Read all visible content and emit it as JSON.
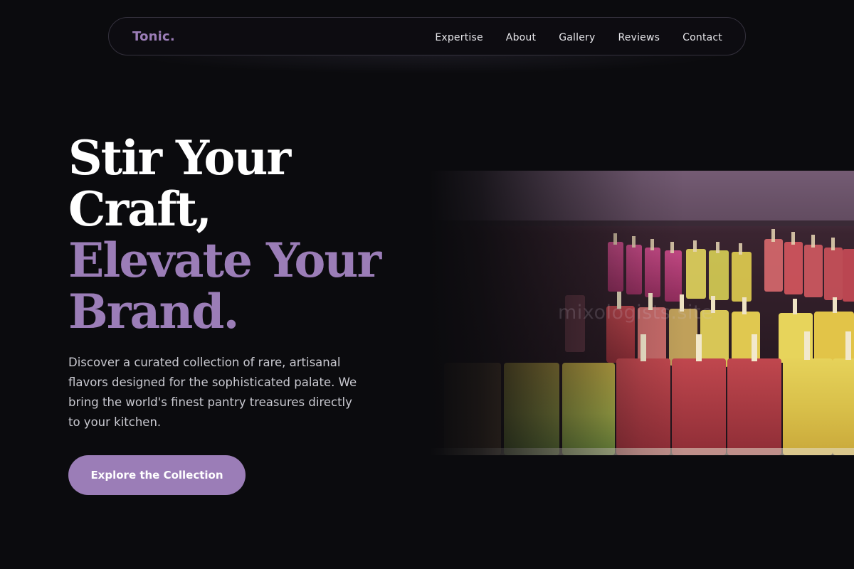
{
  "nav": {
    "brand": "Tonic.",
    "links": [
      "Expertise",
      "About",
      "Gallery",
      "Reviews",
      "Contact"
    ]
  },
  "hero": {
    "headline": [
      "Stir Your",
      "Craft,",
      "Elevate Your",
      "Brand."
    ],
    "description": "Discover a curated collection of rare, artisanal flavors designed for the sophisticated palate. We bring the world's finest pantry treasures directly to your kitchen.",
    "cta_label": "Explore the Collection",
    "image_watermark": "mixologists.site"
  },
  "colors": {
    "background": "#0b0b0e",
    "accent": "#9b7db7",
    "text": "#ffffff",
    "body_text": "#c9c9d0",
    "nav_border": "#34313d"
  }
}
